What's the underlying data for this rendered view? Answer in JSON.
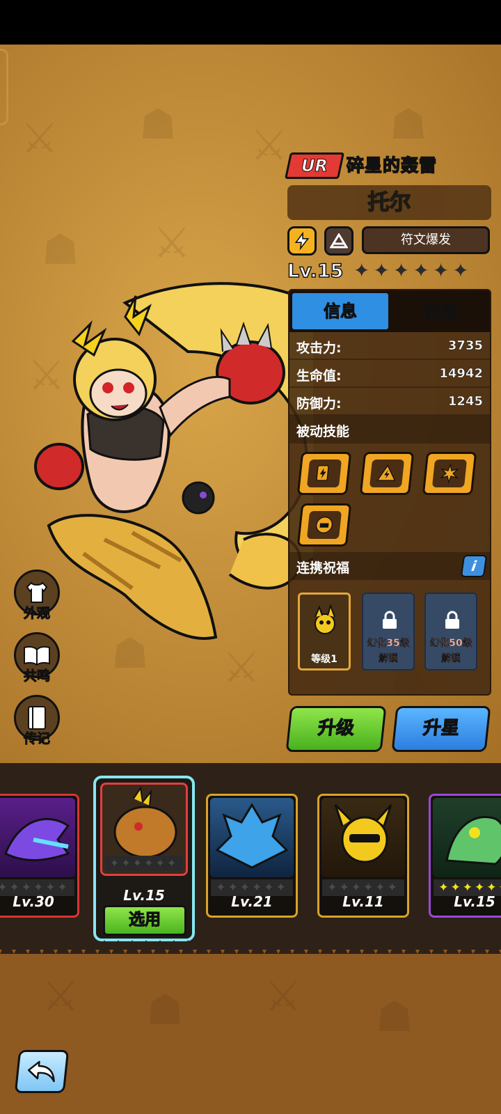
{
  "header": {
    "rarity": "UR",
    "title": "碎星的轰雷",
    "name": "托尔",
    "skill_name": "符文爆发",
    "level": "Lv.15",
    "stars": "✦✦✦✦✦✦"
  },
  "tabs": {
    "info": "信息",
    "blessing": "祝福"
  },
  "stats": [
    {
      "label": "攻击力:",
      "value": "3735"
    },
    {
      "label": "生命值:",
      "value": "14942"
    },
    {
      "label": "防御力:",
      "value": "1245"
    }
  ],
  "sections": {
    "passive": "被动技能",
    "combo": "连携祝福",
    "info_icon": "i"
  },
  "combo_cards": [
    {
      "label": "等级1"
    },
    {
      "label_1": "幻化35级",
      "label_2": "解锁"
    },
    {
      "label_1": "幻化50级",
      "label_2": "解锁"
    }
  ],
  "buttons": {
    "upgrade": "升级",
    "star_up": "升星",
    "select": "选用"
  },
  "side_menu": [
    {
      "label": "外观",
      "icon": "shirt-icon"
    },
    {
      "label": "共鸣",
      "icon": "book-icon"
    },
    {
      "label": "传记",
      "icon": "journal-icon"
    }
  ],
  "roster": [
    {
      "level": "Lv.30",
      "color": "#6a2aa0"
    },
    {
      "level": "Lv.15",
      "color": "#c07a2a"
    },
    {
      "level": "Lv.21",
      "color": "#2a6ec0"
    },
    {
      "level": "Lv.11",
      "color": "#d9a428"
    },
    {
      "level": "Lv.15",
      "color": "#3aa05a"
    }
  ],
  "colors": {
    "accent_blue": "#2f8fe2",
    "accent_green": "#49b11d",
    "rarity_red": "#e33a33",
    "gold": "#f0a623"
  }
}
